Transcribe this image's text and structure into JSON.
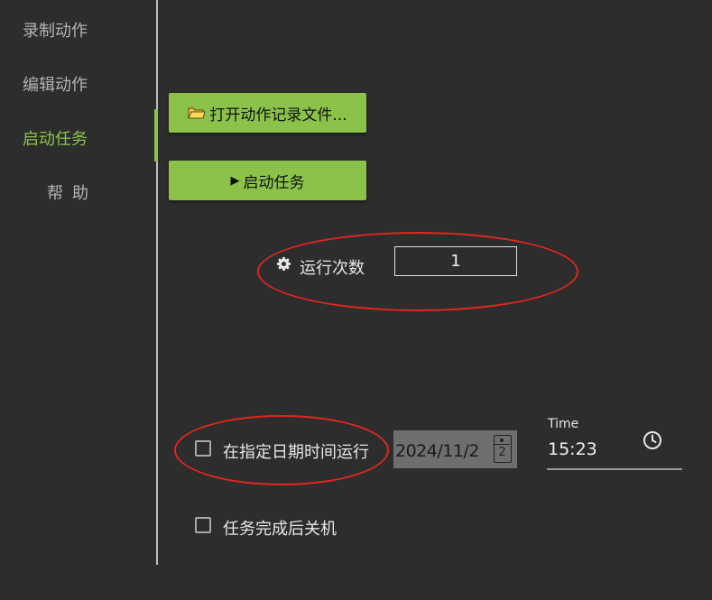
{
  "sidebar": {
    "items": [
      {
        "label": "录制动作"
      },
      {
        "label": "编辑动作"
      },
      {
        "label": "启动任务"
      },
      {
        "label": "帮助"
      }
    ],
    "active_index": 2,
    "accent_color": "#8bc34a"
  },
  "main": {
    "open_button": {
      "label": "打开动作记录文件...",
      "icon": "folder-icon"
    },
    "start_button": {
      "label": "启动任务",
      "icon": "play-icon"
    },
    "run_count": {
      "label": "运行次数",
      "value": "1",
      "icon": "gear-icon"
    },
    "schedule": {
      "checkbox_label": "在指定日期时间运行",
      "checked": false,
      "date": "2024/11/2",
      "calendar_day": "2",
      "time_label": "Time",
      "time": "15:23"
    },
    "shutdown": {
      "label": "任务完成后关机",
      "checked": false
    }
  },
  "annotation_color": "#e0261f"
}
